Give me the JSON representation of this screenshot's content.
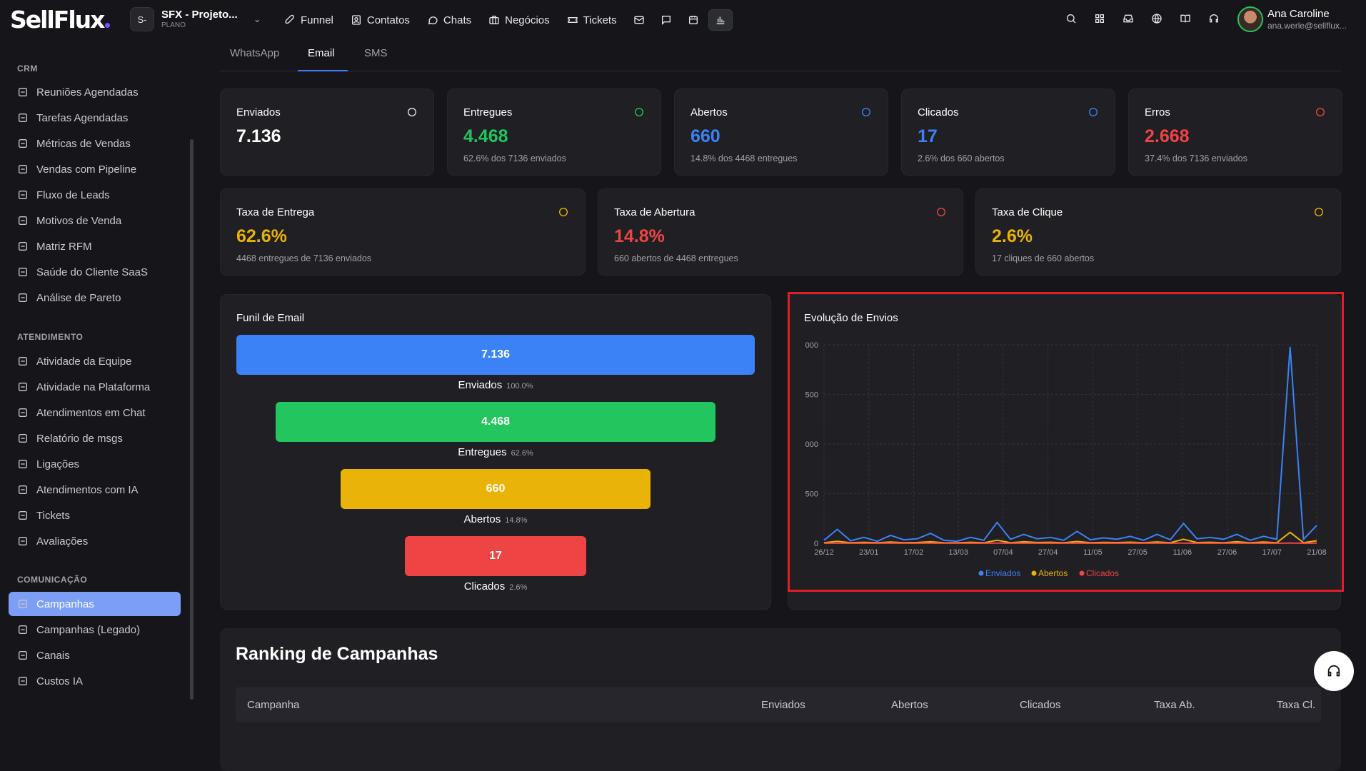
{
  "brand": {
    "logo": "SellFlux"
  },
  "project": {
    "badge": "S-",
    "title": "SFX - Projeto...",
    "subtitle": "PLANO"
  },
  "nav": [
    {
      "label": "Funnel",
      "icon": "rocket-icon"
    },
    {
      "label": "Contatos",
      "icon": "contacts-icon"
    },
    {
      "label": "Chats",
      "icon": "chat-icon"
    },
    {
      "label": "Negócios",
      "icon": "briefcase-icon"
    },
    {
      "label": "Tickets",
      "icon": "ticket-icon"
    }
  ],
  "user": {
    "name": "Ana Caroline",
    "email": "ana.werle@sellflux..."
  },
  "sidebar": {
    "crm_title": "CRM",
    "crm": [
      "Reuniões Agendadas",
      "Tarefas Agendadas",
      "Métricas de Vendas",
      "Vendas com Pipeline",
      "Fluxo de Leads",
      "Motivos de Venda",
      "Matriz RFM",
      "Saúde do Cliente SaaS",
      "Análise de Pareto"
    ],
    "atend_title": "ATENDIMENTO",
    "atend": [
      "Atividade da Equipe",
      "Atividade na Plataforma",
      "Atendimentos em Chat",
      "Relatório de msgs",
      "Ligações",
      "Atendimentos com IA",
      "Tickets",
      "Avaliações"
    ],
    "com_title": "COMUNICAÇÃO",
    "com": [
      "Campanhas",
      "Campanhas (Legado)",
      "Canais",
      "Custos IA"
    ]
  },
  "tabs": [
    "WhatsApp",
    "Email",
    "SMS"
  ],
  "stats": [
    {
      "label": "Enviados",
      "value": "7.136",
      "sub": "",
      "color": "#ffffff",
      "icon": "mail-icon"
    },
    {
      "label": "Entregues",
      "value": "4.468",
      "sub": "62.6% dos 7136 enviados",
      "color": "#22c55e",
      "icon": "check-circle-icon"
    },
    {
      "label": "Abertos",
      "value": "660",
      "sub": "14.8% dos 4468 entregues",
      "color": "#3b82f6",
      "icon": "eye-icon"
    },
    {
      "label": "Clicados",
      "value": "17",
      "sub": "2.6% dos 660 abertos",
      "color": "#3b82f6",
      "icon": "cursor-icon"
    },
    {
      "label": "Erros",
      "value": "2.668",
      "sub": "37.4% dos 7136 enviados",
      "color": "#ef4444",
      "icon": "x-circle-icon"
    }
  ],
  "rates": [
    {
      "label": "Taxa de Entrega",
      "value": "62.6%",
      "sub": "4468 entregues de 7136 enviados",
      "color": "#eab308",
      "icon": "trend-up-icon"
    },
    {
      "label": "Taxa de Abertura",
      "value": "14.8%",
      "sub": "660 abertos de 4468 entregues",
      "color": "#ef4444",
      "icon": "eye-icon"
    },
    {
      "label": "Taxa de Clique",
      "value": "2.6%",
      "sub": "17 cliques de 660 abertos",
      "color": "#eab308",
      "icon": "cursor-icon"
    }
  ],
  "funnel": {
    "title": "Funil de Email",
    "stages": [
      {
        "value": "7.136",
        "label": "Enviados",
        "pct": "100.0%",
        "color": "#3b82f6"
      },
      {
        "value": "4.468",
        "label": "Entregues",
        "pct": "62.6%",
        "color": "#22c55e"
      },
      {
        "value": "660",
        "label": "Abertos",
        "pct": "14.8%",
        "color": "#eab308"
      },
      {
        "value": "17",
        "label": "Clicados",
        "pct": "2.6%",
        "color": "#ef4444"
      }
    ]
  },
  "chart_data": {
    "type": "line",
    "title": "Evolução de Envios",
    "x": [
      "26/12",
      "23/01",
      "17/02",
      "13/03",
      "07/04",
      "27/04",
      "11/05",
      "27/05",
      "11/06",
      "27/06",
      "17/07",
      "21/08"
    ],
    "ytick_labels": [
      "000",
      "500",
      "000",
      "500",
      "0"
    ],
    "ylim": [
      0,
      2000
    ],
    "grid": true,
    "legend": "bottom",
    "series": [
      {
        "name": "Enviados",
        "color": "#3b82f6",
        "values": [
          30,
          140,
          25,
          60,
          20,
          80,
          35,
          45,
          100,
          30,
          20,
          60,
          30,
          210,
          40,
          90,
          45,
          60,
          30,
          120,
          35,
          55,
          40,
          70,
          30,
          90,
          35,
          200,
          45,
          60,
          40,
          90,
          30,
          70,
          40,
          1980,
          40,
          180
        ]
      },
      {
        "name": "Abertos",
        "color": "#eab308",
        "values": [
          5,
          20,
          5,
          10,
          5,
          12,
          6,
          8,
          15,
          5,
          4,
          10,
          5,
          30,
          6,
          15,
          8,
          10,
          5,
          18,
          6,
          9,
          7,
          11,
          5,
          14,
          6,
          40,
          7,
          10,
          6,
          15,
          5,
          12,
          6,
          110,
          6,
          25
        ]
      },
      {
        "name": "Clicados",
        "color": "#ef4444",
        "values": [
          0,
          1,
          0,
          0,
          0,
          1,
          0,
          0,
          1,
          0,
          0,
          0,
          0,
          2,
          0,
          1,
          0,
          0,
          0,
          1,
          0,
          0,
          0,
          1,
          0,
          1,
          0,
          2,
          0,
          0,
          0,
          1,
          0,
          0,
          0,
          3,
          0,
          1
        ]
      }
    ]
  },
  "ranking": {
    "title": "Ranking de Campanhas",
    "columns": [
      "Campanha",
      "Enviados",
      "Abertos",
      "Clicados",
      "Taxa Ab.",
      "Taxa Cl."
    ]
  }
}
